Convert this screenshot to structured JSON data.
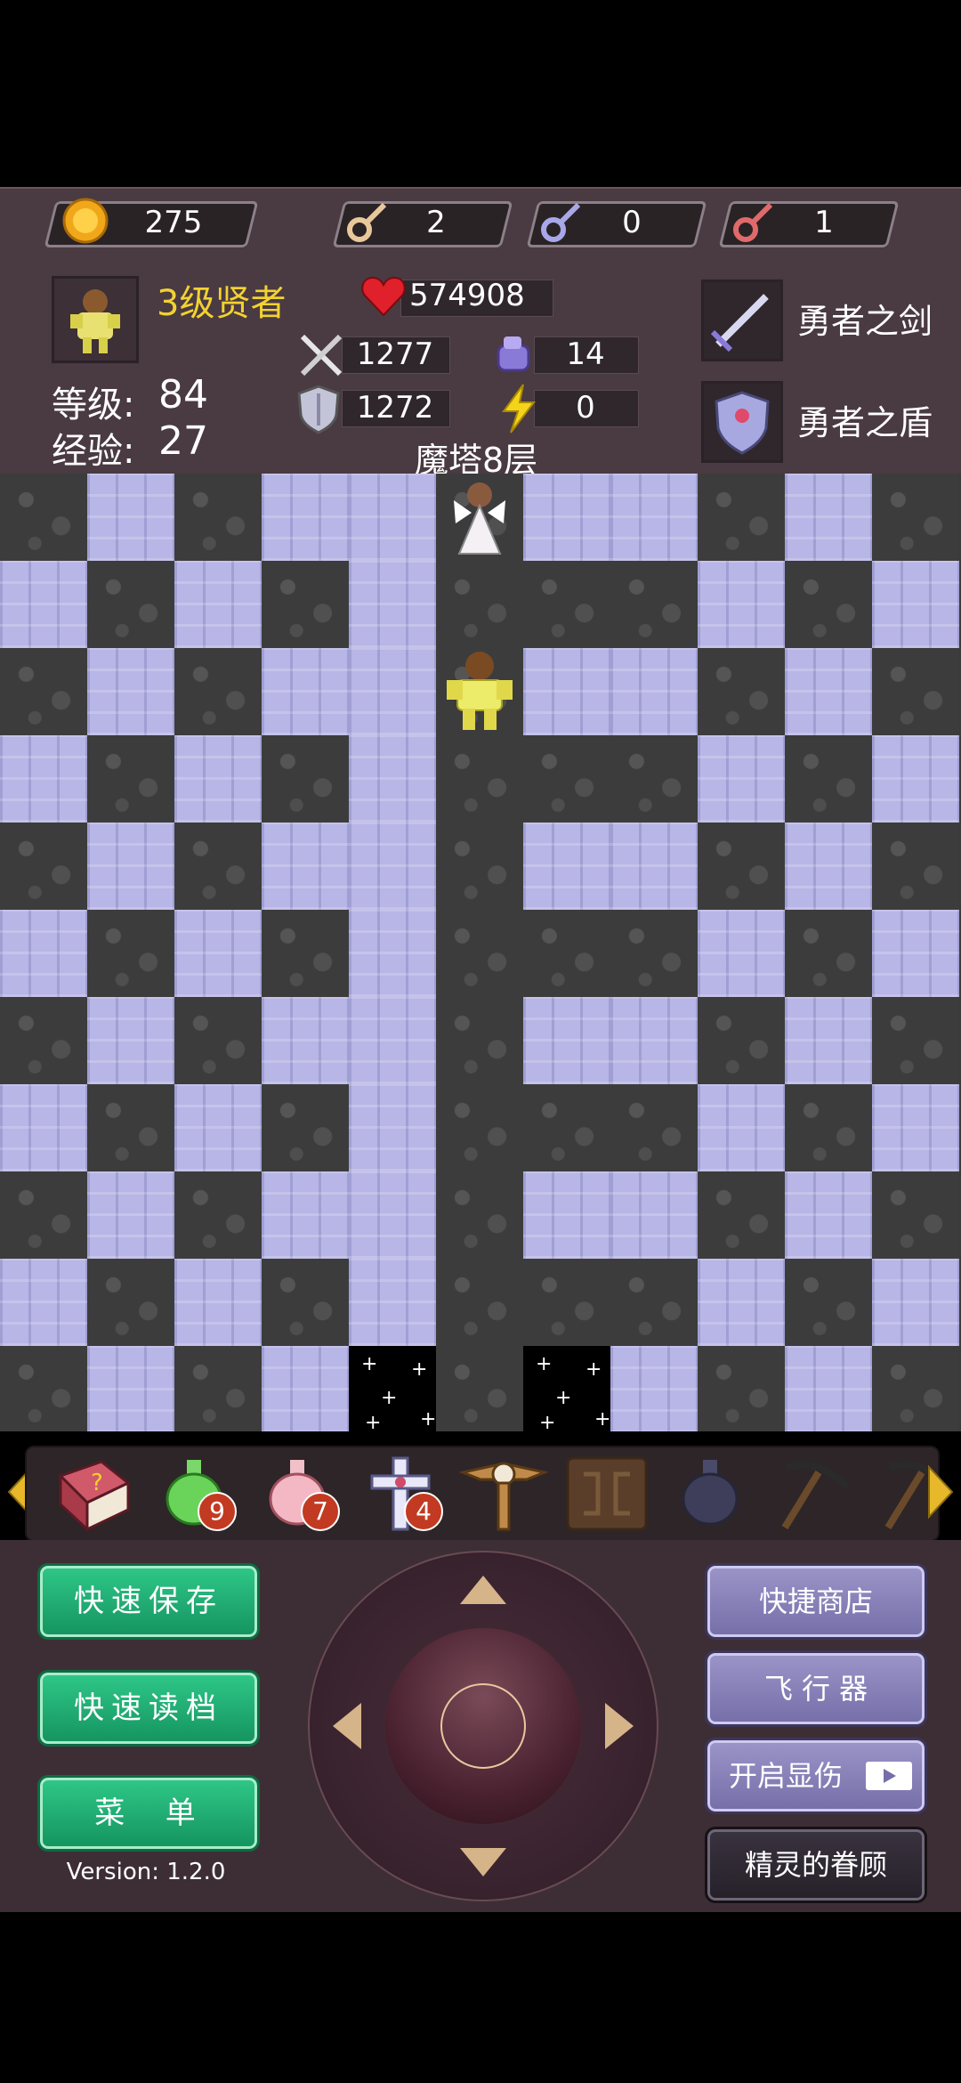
{
  "resources": {
    "coins": "275",
    "yellow_keys": "2",
    "blue_keys": "0",
    "red_keys": "1"
  },
  "hero": {
    "title": "3级贤者",
    "level_label": "等级:",
    "level_value": "84",
    "exp_label": "经验:",
    "exp_value": "27"
  },
  "stats": {
    "hp": "574908",
    "attack": "1277",
    "defense": "1272",
    "magic_defense": "14",
    "energy": "0"
  },
  "equipment": {
    "weapon": "勇者之剑",
    "shield": "勇者之盾"
  },
  "floor_label": "魔塔8层",
  "items": [
    {
      "name": "monster-manual-icon",
      "count": ""
    },
    {
      "name": "green-potion-icon",
      "count": "9"
    },
    {
      "name": "pink-potion-icon",
      "count": "7"
    },
    {
      "name": "holy-cross-icon",
      "count": "4"
    },
    {
      "name": "winged-staff-icon",
      "count": ""
    },
    {
      "name": "ancient-tablet-icon",
      "count": ""
    },
    {
      "name": "dark-urn-icon",
      "count": ""
    },
    {
      "name": "pickaxe-icon",
      "count": ""
    },
    {
      "name": "pickaxe2-icon",
      "count": ""
    }
  ],
  "buttons": {
    "quick_save": "快速保存",
    "quick_load": "快速读档",
    "menu": "菜  单",
    "shop": "快捷商店",
    "fly": "飞 行 器",
    "damage_display": "开启显伤",
    "fairy": "精灵的眷顾"
  },
  "version": "Version: 1.2.0",
  "colors": {
    "panel": "#4a3a42",
    "wall": "#b8b6e6",
    "floor": "#3c3c3c",
    "accent_yellow": "#f2d230",
    "green_button": "#1fae72",
    "purple_button": "#8a83bb"
  }
}
